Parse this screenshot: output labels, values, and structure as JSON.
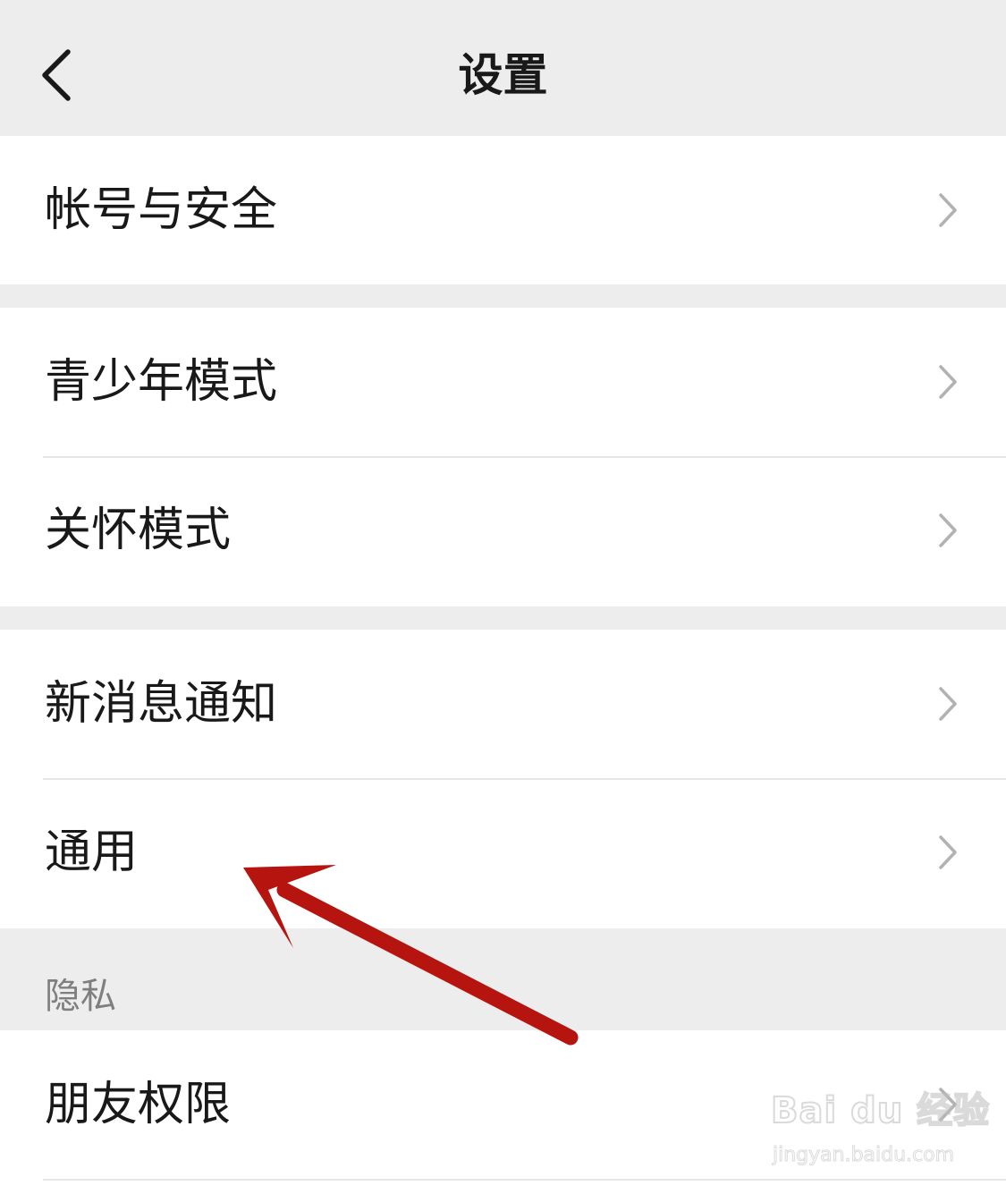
{
  "header": {
    "back_icon": "chevron-left-icon",
    "title": "设置"
  },
  "groups": [
    {
      "items": [
        {
          "label": "帐号与安全"
        }
      ]
    },
    {
      "items": [
        {
          "label": "青少年模式"
        },
        {
          "label": "关怀模式"
        }
      ]
    },
    {
      "items": [
        {
          "label": "新消息通知"
        },
        {
          "label": "通用"
        }
      ]
    }
  ],
  "privacy_section": {
    "title": "隐私",
    "items": [
      {
        "label": "朋友权限"
      }
    ]
  },
  "row_icon": "chevron-right-icon",
  "annotation": {
    "type": "arrow",
    "color": "#b5140f",
    "points_to": "通用"
  },
  "watermark": {
    "logo": "Bai du 经验",
    "url": "jingyan.baidu.com"
  },
  "colors": {
    "background": "#ededed",
    "row_background": "#ffffff",
    "text": "#191919",
    "section_title": "#7f7f7f",
    "chevron": "#b2b2b2"
  }
}
